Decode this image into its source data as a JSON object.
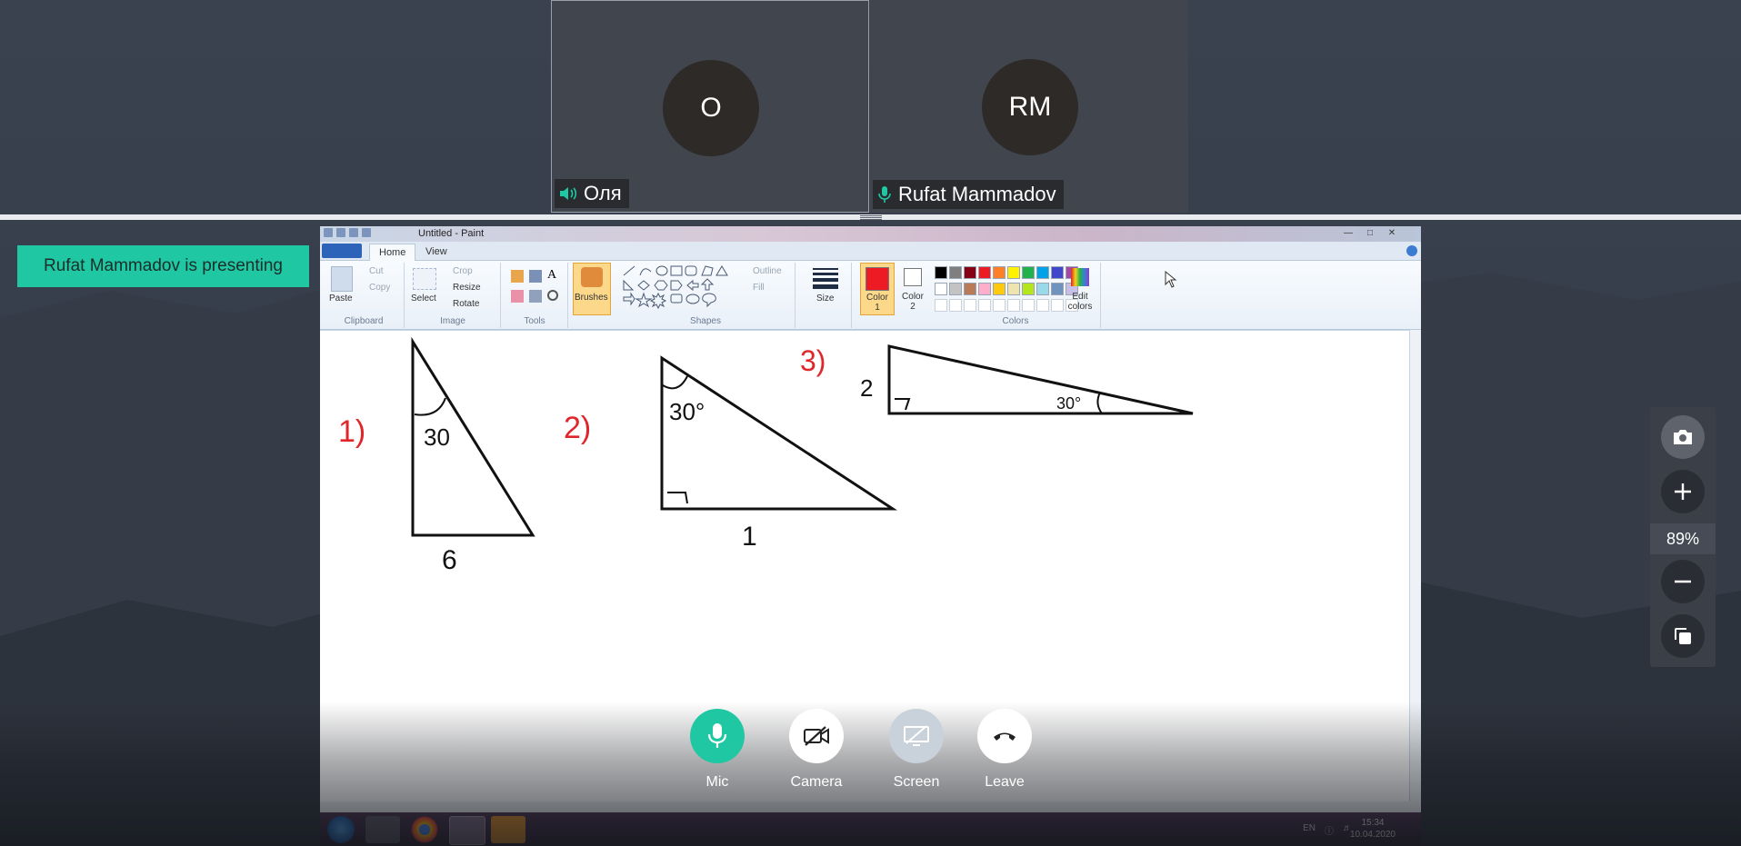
{
  "participants": [
    {
      "initials": "О",
      "name": "Оля",
      "audio": "speaker-icon"
    },
    {
      "initials": "RM",
      "name": "Rufat Mammadov",
      "audio": "mic-icon"
    }
  ],
  "banner": {
    "text": "Rufat Mammadov is presenting"
  },
  "paint": {
    "title": "Untitled - Paint",
    "tabs": [
      "Home",
      "View"
    ],
    "clipboard": {
      "paste": "Paste",
      "cut": "Cut",
      "copy": "Copy",
      "group": "Clipboard"
    },
    "image": {
      "select": "Select",
      "crop": "Crop",
      "resize": "Resize",
      "rotate": "Rotate",
      "group": "Image"
    },
    "tools": {
      "group": "Tools"
    },
    "brushes": "Brushes",
    "shapes": {
      "outline": "Outline",
      "fill": "Fill",
      "group": "Shapes"
    },
    "size": "Size",
    "color1": "Color 1",
    "color2": "Color 2",
    "edit_colors": "Edit colors",
    "colors_group": "Colors",
    "palette_row1": [
      "#000000",
      "#7f7f7f",
      "#880015",
      "#ed1c24",
      "#ff7f27",
      "#fff200",
      "#22b14c",
      "#00a2e8",
      "#3f48cc",
      "#a349a4"
    ],
    "palette_row2": [
      "#ffffff",
      "#c3c3c3",
      "#b97a57",
      "#ffaec9",
      "#ffc90e",
      "#efe4b0",
      "#b5e61d",
      "#99d9ea",
      "#7092be",
      "#c8bfe7"
    ],
    "color1_value": "#ed1c24",
    "color2_value": "#ffffff"
  },
  "drawing": {
    "labels": [
      {
        "text": "1)",
        "color": "#e0262b"
      },
      {
        "text": "30",
        "color": "#111"
      },
      {
        "text": "6",
        "color": "#111"
      },
      {
        "text": "2)",
        "color": "#e0262b"
      },
      {
        "text": "30°",
        "color": "#111"
      },
      {
        "text": "1",
        "color": "#111"
      },
      {
        "text": "3)",
        "color": "#e0262b"
      },
      {
        "text": "2",
        "color": "#111"
      },
      {
        "text": "30°",
        "color": "#111"
      }
    ]
  },
  "taskbar": {
    "lang": "EN",
    "time": "15:34",
    "date": "10.04.2020"
  },
  "controls": [
    {
      "label": "Mic",
      "icon": "mic-icon",
      "bg": "#1fc7a3"
    },
    {
      "label": "Camera",
      "icon": "camera-off-icon",
      "bg": "#ffffff"
    },
    {
      "label": "Screen",
      "icon": "screen-share-off-icon",
      "bg": "#c9d1db"
    },
    {
      "label": "Leave",
      "icon": "phone-hangup-icon",
      "bg": "#ffffff"
    }
  ],
  "zoom": {
    "value": "89%"
  }
}
